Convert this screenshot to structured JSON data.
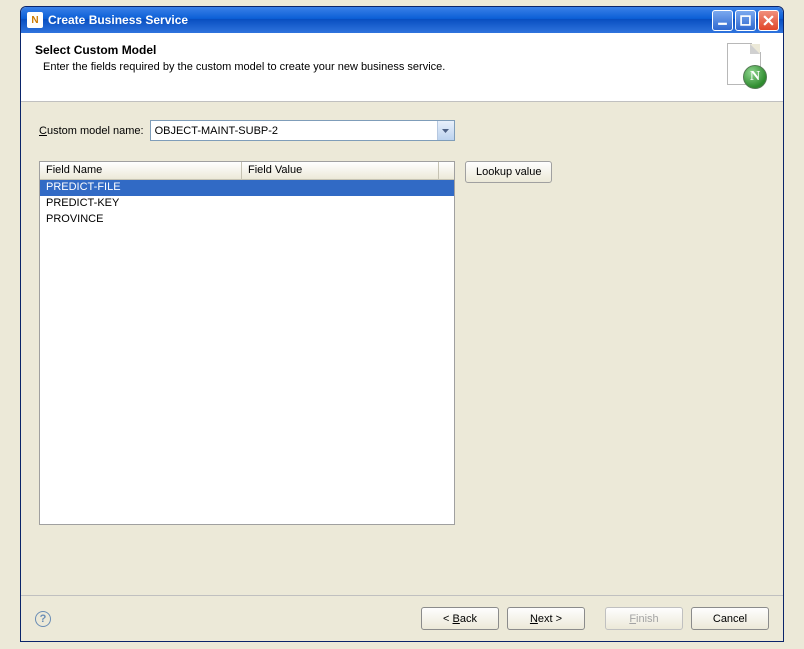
{
  "titlebar": {
    "title": "Create Business Service",
    "app_icon_letter": "N"
  },
  "header": {
    "title": "Select Custom Model",
    "description": "Enter the fields required by the custom model to create your new business service.",
    "badge_letter": "N"
  },
  "form": {
    "model_label_pre": "C",
    "model_label_rest": "ustom model name:",
    "model_value": "OBJECT-MAINT-SUBP-2"
  },
  "grid": {
    "columns": {
      "name": "Field Name",
      "value": "Field Value"
    },
    "rows": [
      {
        "name": "PREDICT-FILE",
        "value": "",
        "selected": true
      },
      {
        "name": "PREDICT-KEY",
        "value": "",
        "selected": false
      },
      {
        "name": "PROVINCE",
        "value": "",
        "selected": false
      }
    ]
  },
  "buttons": {
    "lookup": "Lookup value",
    "back": "< Back",
    "next": "Next >",
    "finish": "Finish",
    "cancel": "Cancel",
    "back_ul": "B",
    "next_ul": "N",
    "finish_ul": "F"
  }
}
